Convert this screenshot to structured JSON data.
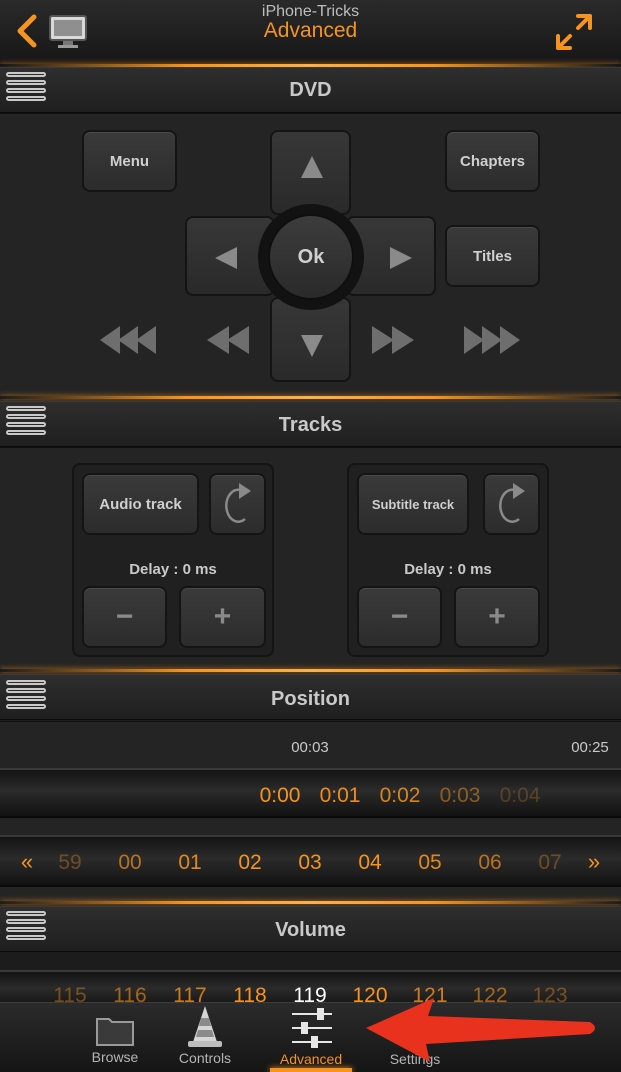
{
  "header": {
    "subtitle": "iPhone-Tricks",
    "title": "Advanced"
  },
  "dvd": {
    "title": "DVD",
    "menu_label": "Menu",
    "chapters_label": "Chapters",
    "titles_label": "Titles",
    "ok_label": "Ok"
  },
  "tracks": {
    "title": "Tracks",
    "audio_label": "Audio track",
    "subtitle_label": "Subtitle track",
    "audio_delay": "Delay : 0 ms",
    "subtitle_delay": "Delay : 0 ms",
    "minus": "−",
    "plus": "+"
  },
  "position": {
    "title": "Position",
    "current_time": "00:03",
    "total_time": "00:25",
    "seconds": [
      "0:00",
      "0:01",
      "0:02",
      "0:03",
      "0:04"
    ],
    "frames": [
      "59",
      "00",
      "01",
      "02",
      "03",
      "04",
      "05",
      "06",
      "07"
    ],
    "prev_glyph": "«",
    "next_glyph": "»"
  },
  "volume": {
    "title": "Volume",
    "values": [
      "115",
      "116",
      "117",
      "118",
      "119",
      "120",
      "121",
      "122",
      "123"
    ]
  },
  "tabbar": {
    "browse": "Browse",
    "controls": "Controls",
    "advanced": "Advanced",
    "settings": "Settings"
  },
  "colors": {
    "accent": "#f6941d",
    "annotation_arrow": "#e8321e"
  }
}
